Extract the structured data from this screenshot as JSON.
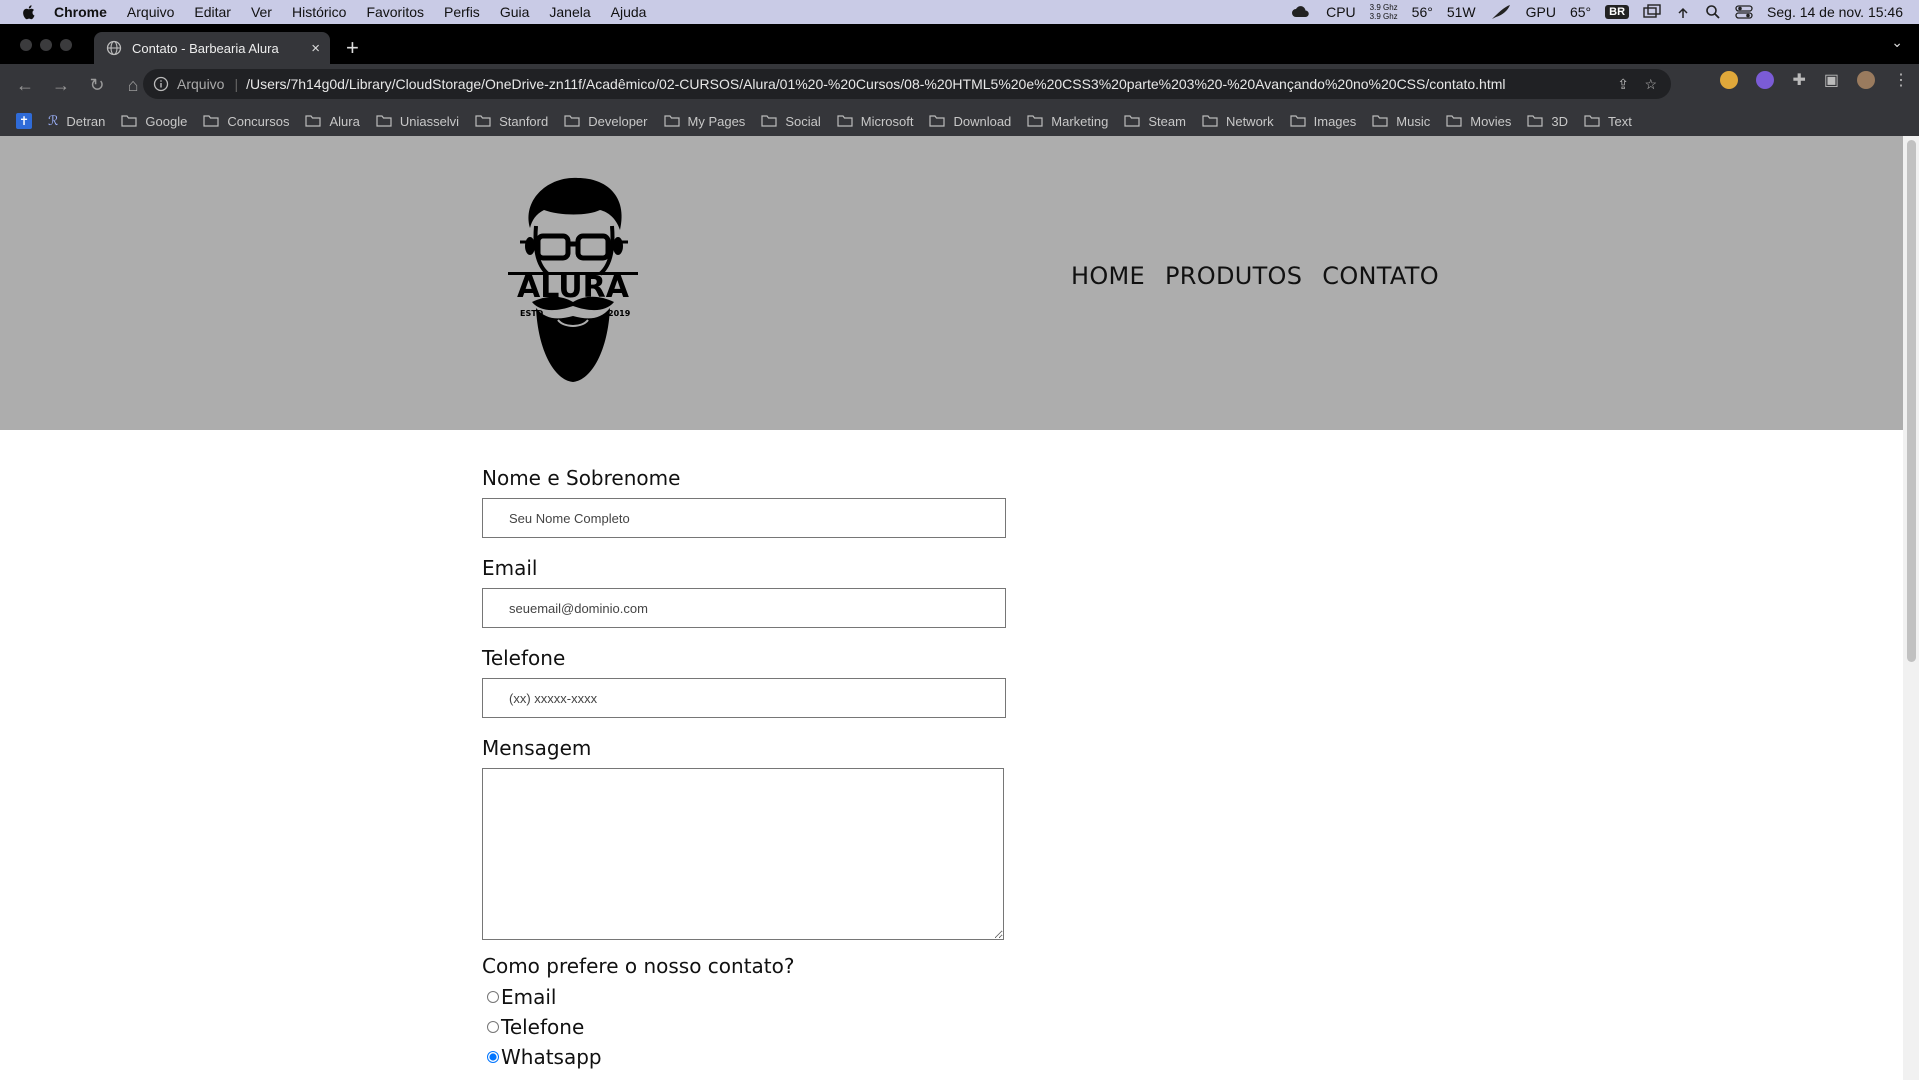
{
  "menubar": {
    "app": "Chrome",
    "items": [
      "Arquivo",
      "Editar",
      "Ver",
      "Histórico",
      "Favoritos",
      "Perfis",
      "Guia",
      "Janela",
      "Ajuda"
    ],
    "cpu_label": "CPU",
    "cpu_freq_top": "3.9 Ghz",
    "cpu_freq_bottom": "3.9 Ghz",
    "cpu_temp": "56°",
    "power": "51W",
    "gpu_label": "GPU",
    "gpu_temp": "65°",
    "lang": "BR",
    "datetime": "Seg. 14 de nov.  15:46"
  },
  "tab": {
    "title": "Contato - Barbearia Alura",
    "close": "×",
    "new": "+"
  },
  "toolbar": {
    "scheme": "Arquivo",
    "url": "/Users/7h14g0d/Library/CloudStorage/OneDrive-zn11f/Acadêmico/02-CURSOS/Alura/01%20-%20Cursos/08-%20HTML5%20e%20CSS3%20parte%203%20-%20Avançando%20no%20CSS/contato.html"
  },
  "bookmarks": [
    "Detran",
    "Google",
    "Concursos",
    "Alura",
    "Uniasselvi",
    "Stanford",
    "Developer",
    "My Pages",
    "Social",
    "Microsoft",
    "Download",
    "Marketing",
    "Steam",
    "Network",
    "Images",
    "Music",
    "Movies",
    "3D",
    "Text"
  ],
  "site": {
    "logo_text": "ALURA",
    "logo_estd": "ESTD",
    "logo_year": "2019",
    "nav": [
      "HOME",
      "PRODUTOS",
      "CONTATO"
    ]
  },
  "form": {
    "name_label": "Nome e Sobrenome",
    "name_placeholder": "Seu Nome Completo",
    "email_label": "Email",
    "email_placeholder": "seuemail@dominio.com",
    "phone_label": "Telefone",
    "phone_placeholder": "(xx) xxxxx-xxxx",
    "message_label": "Mensagem",
    "contact_question": "Como prefere o nosso contato?",
    "options": [
      "Email",
      "Telefone",
      "Whatsapp"
    ],
    "selected_option": "Whatsapp"
  },
  "colors": {
    "menubar": "#c9cbe6",
    "chrome_dark": "#35363a",
    "header_bg": "#adadad",
    "radio_accent": "#1a73e8"
  }
}
